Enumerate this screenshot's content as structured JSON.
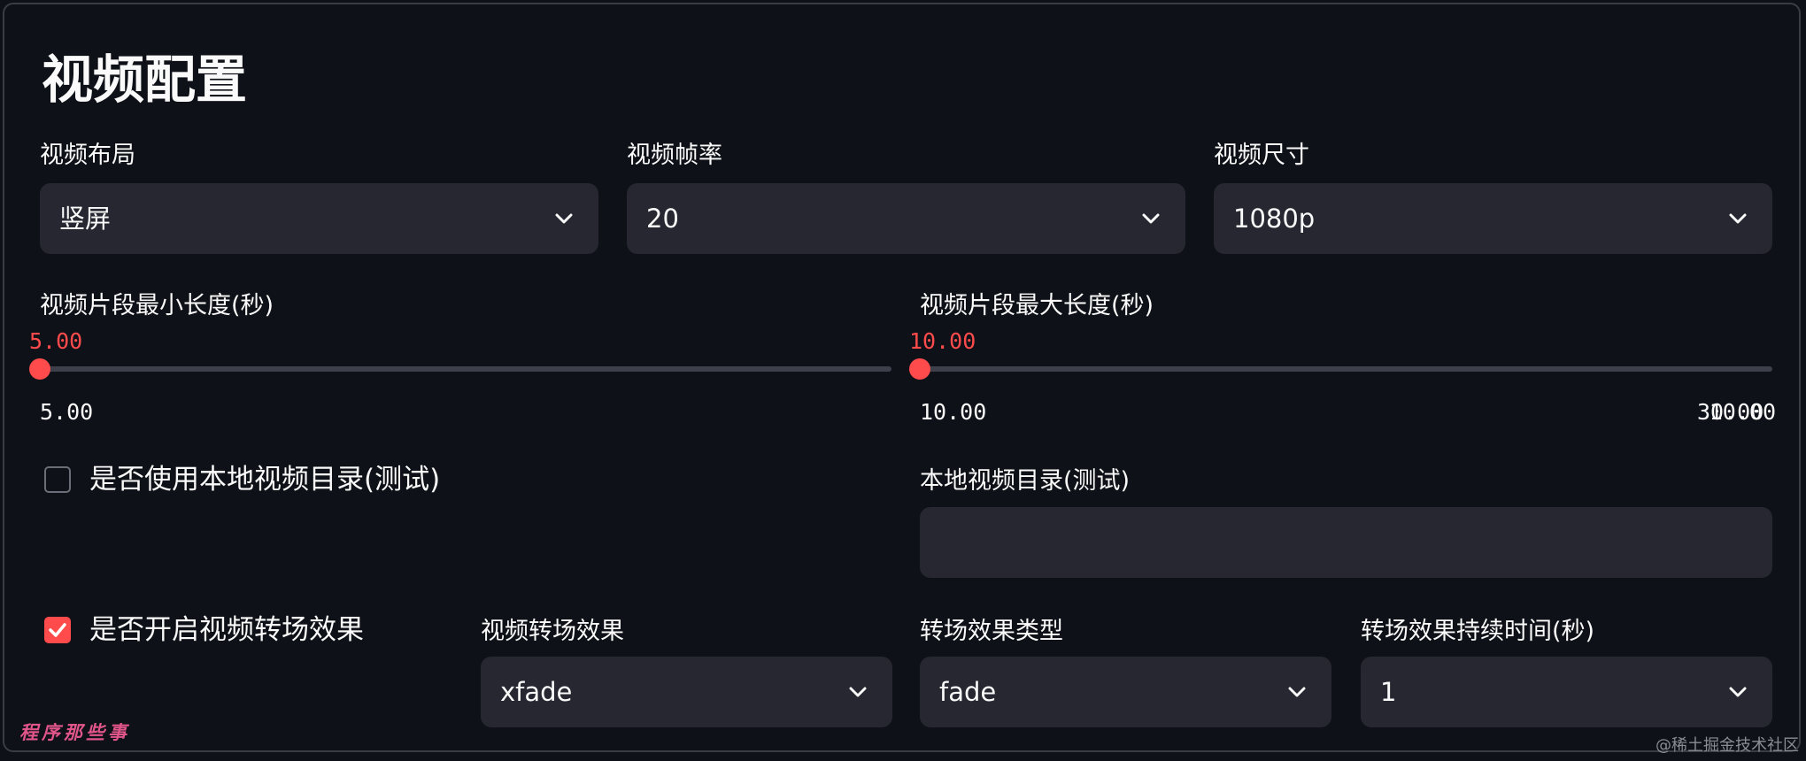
{
  "title": "视频配置",
  "layout_select": {
    "label": "视频布局",
    "value": "竖屏"
  },
  "fps_select": {
    "label": "视频帧率",
    "value": "20"
  },
  "size_select": {
    "label": "视频尺寸",
    "value": "1080p"
  },
  "min_length_slider": {
    "label": "视频片段最小长度(秒)",
    "current": "5.00",
    "min": "5.00",
    "max": "10.00",
    "fraction": 0.0
  },
  "max_length_slider": {
    "label": "视频片段最大长度(秒)",
    "current": "10.00",
    "min": "10.00",
    "max": "30.00",
    "fraction": 0.0
  },
  "local_dir_checkbox": {
    "label": "是否使用本地视频目录(测试)",
    "checked": false
  },
  "local_dir_input": {
    "label": "本地视频目录(测试)",
    "value": ""
  },
  "transition_checkbox": {
    "label": "是否开启视频转场效果",
    "checked": true
  },
  "transition_effect_select": {
    "label": "视频转场效果",
    "value": "xfade"
  },
  "transition_type_select": {
    "label": "转场效果类型",
    "value": "fade"
  },
  "transition_duration_select": {
    "label": "转场效果持续时间(秒)",
    "value": "1"
  },
  "watermarks": {
    "left": "程序那些事",
    "right": "@稀土掘金技术社区"
  },
  "colors": {
    "accent": "#ff4b4b",
    "background": "#0e1117",
    "input_bg": "#262730",
    "text": "#fafafa"
  },
  "icons": {
    "select_arrow": "chevron-down-icon",
    "checkbox_check": "check-icon"
  }
}
